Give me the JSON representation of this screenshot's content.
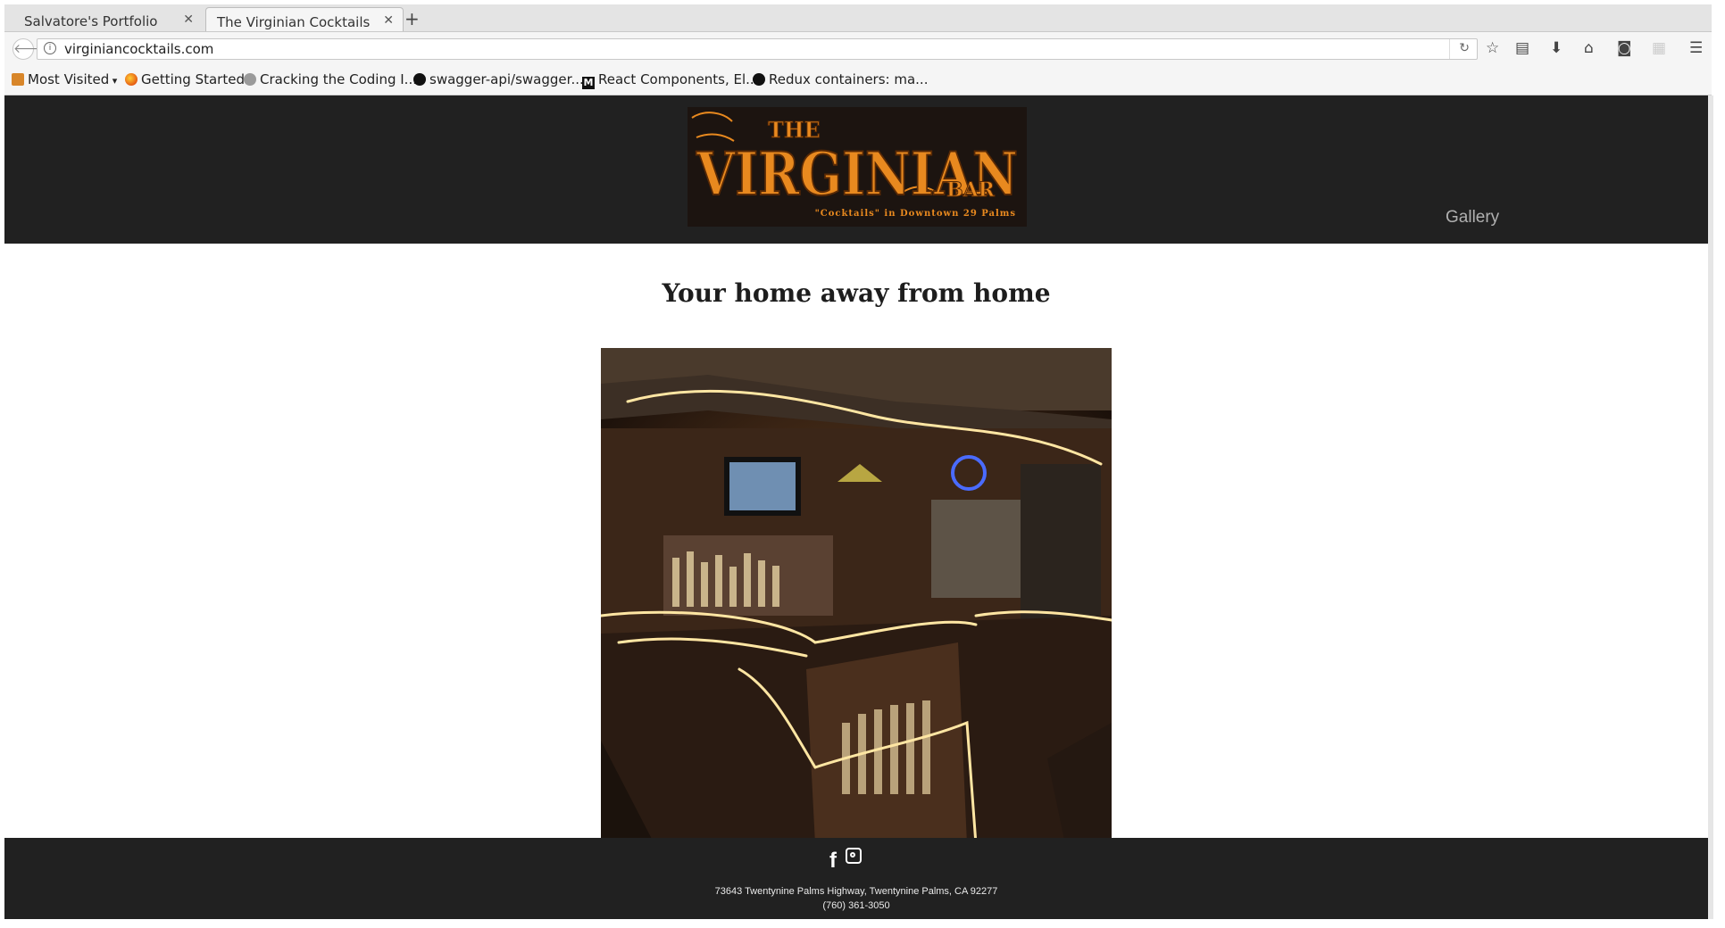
{
  "browser": {
    "tabs": [
      {
        "title": "Salvatore's Portfolio",
        "active": false
      },
      {
        "title": "The Virginian Cocktails",
        "active": true
      }
    ],
    "new_tab_label": "+",
    "url": "virginiancocktails.com",
    "bookmarks": [
      {
        "label": "Most Visited",
        "icon": "folder-icon"
      },
      {
        "label": "Getting Started",
        "icon": "firefox-icon"
      },
      {
        "label": "Cracking the Coding I...",
        "icon": "globe-icon"
      },
      {
        "label": "swagger-api/swagger...",
        "icon": "github-icon"
      },
      {
        "label": "React Components, El...",
        "icon": "medium-icon"
      },
      {
        "label": "Redux containers: ma...",
        "icon": "github-icon"
      }
    ],
    "toolbar_icons": [
      "star-icon",
      "reading-list-icon",
      "download-icon",
      "home-icon",
      "pocket-icon",
      "extension-icon",
      "menu-icon"
    ]
  },
  "site": {
    "logo": {
      "line1": "THE",
      "line2": "VIRGINIAN",
      "line3": "BAR",
      "line4": "\"Cocktails\" in Downtown 29 Palms"
    },
    "nav": {
      "gallery": "Gallery"
    },
    "tagline": "Your home away from home",
    "footer": {
      "address": "73643 Twentynine Palms Highway, Twentynine Palms, CA 92277",
      "phone": "(760) 361-3050",
      "social_icons": [
        "facebook-icon",
        "instagram-icon"
      ]
    },
    "colors": {
      "header_bg": "#212121",
      "logo_orange": "#e8891f",
      "gallery_text": "#b0b0b0"
    }
  }
}
